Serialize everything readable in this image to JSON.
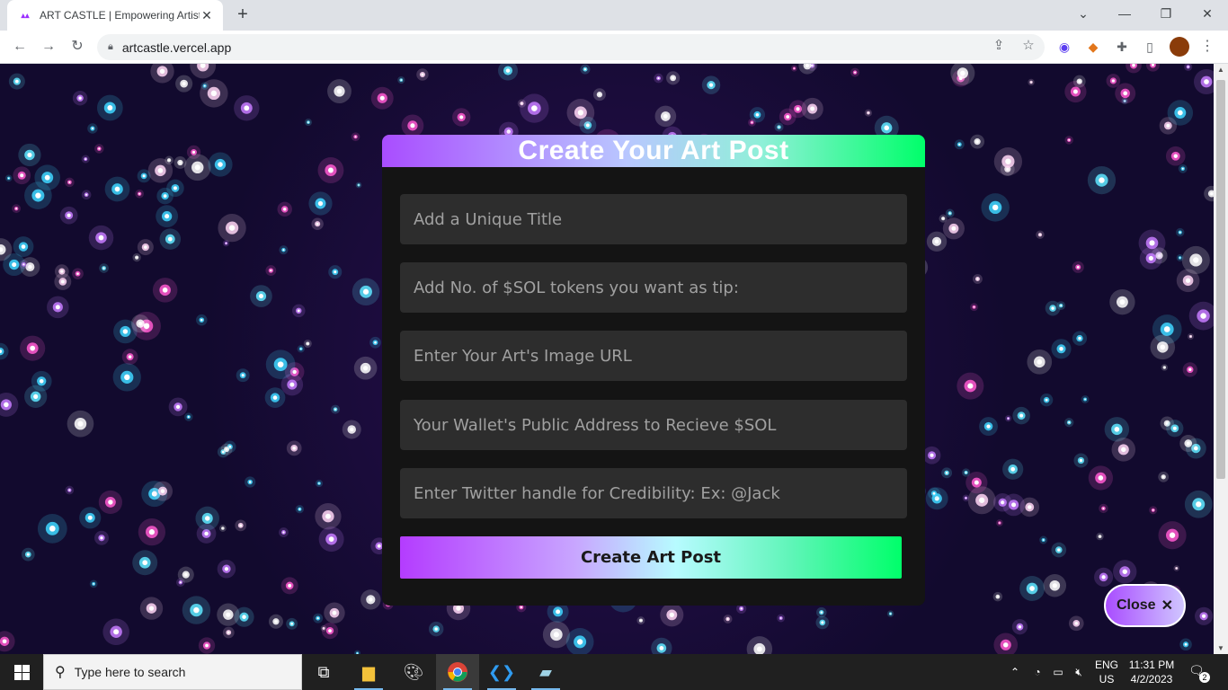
{
  "browser": {
    "tab_title": "ART CASTLE | Empowering Artists",
    "tab_favicon": "art-castle-favicon",
    "url": "artcastle.vercel.app",
    "new_tab_label": "+"
  },
  "modal": {
    "title": "Create Your Art Post",
    "fields": {
      "title_placeholder": "Add a Unique Title",
      "tip_placeholder": "Add No. of $SOL tokens you want as tip:",
      "image_placeholder": "Enter Your Art's Image URL",
      "wallet_placeholder": "Your Wallet's Public Address to Recieve $SOL",
      "twitter_placeholder": "Enter Twitter handle for Credibility: Ex: @Jack"
    },
    "submit_label": "Create Art Post"
  },
  "close_button": {
    "label": "Close",
    "icon": "✕"
  },
  "taskbar": {
    "search_placeholder": "Type here to search",
    "language": "ENG",
    "region": "US",
    "time": "11:31 PM",
    "date": "4/2/2023",
    "notification_count": "2"
  },
  "colors": {
    "accent_purple": "#a94dff",
    "accent_green": "#00ff6a",
    "modal_bg": "#141414",
    "field_bg": "#2d2d2d"
  }
}
